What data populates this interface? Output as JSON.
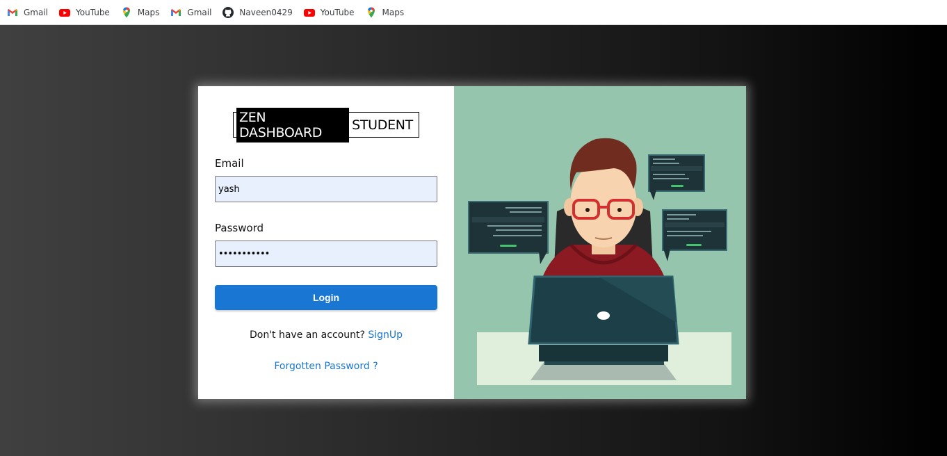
{
  "bookmarks": [
    {
      "label": "Gmail",
      "icon": "gmail-icon"
    },
    {
      "label": "YouTube",
      "icon": "youtube-icon"
    },
    {
      "label": "Maps",
      "icon": "maps-icon"
    },
    {
      "label": "Gmail",
      "icon": "gmail-icon"
    },
    {
      "label": "Naveen0429",
      "icon": "github-icon"
    },
    {
      "label": "YouTube",
      "icon": "youtube-icon"
    },
    {
      "label": "Maps",
      "icon": "maps-icon"
    }
  ],
  "brand": {
    "primary": "ZEN DASHBOARD",
    "secondary": "STUDENT"
  },
  "form": {
    "email_label": "Email",
    "email_value": "yash",
    "password_label": "Password",
    "password_value": "•••••••••••",
    "login_label": "Login",
    "signup_prompt": "Don't have an account?",
    "signup_link": "SignUp",
    "forgot_link": "Forgotten Password ?"
  },
  "colors": {
    "accent": "#1976d2",
    "input_bg": "#e8f0fe",
    "illustration_bg": "#95c5ad"
  },
  "illustration": {
    "icon": "developer-at-laptop-illustration"
  }
}
